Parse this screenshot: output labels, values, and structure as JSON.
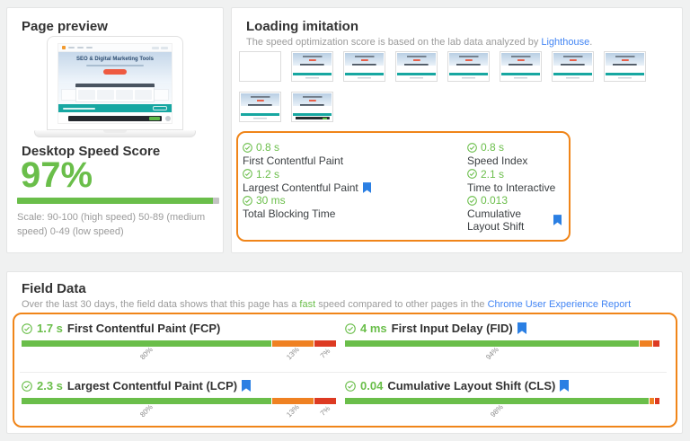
{
  "colors": {
    "green": "#6abe4a",
    "orange": "#ef8122",
    "red": "#dd3a22",
    "link_blue": "#4285f4",
    "bookmark_blue": "#2b7fe3",
    "highlight_border": "#f08519"
  },
  "page_preview": {
    "title": "Page preview",
    "site_heading": "SEO & Digital Marketing Tools",
    "score_heading": "Desktop Speed Score",
    "score_value": "97%",
    "score_percent": 97,
    "scale_note": "Scale: 90-100 (high speed) 50-89 (medium speed) 0-49 (low speed)"
  },
  "loading_imitation": {
    "title": "Loading imitation",
    "subtitle": {
      "prefix": "The speed optimization score is based on the lab data analyzed by ",
      "link": "Lighthouse",
      "suffix": "."
    },
    "filmstrip": {
      "frames": [
        "blank",
        "loaded",
        "loaded",
        "loaded",
        "loaded",
        "loaded",
        "loaded",
        "loaded",
        "loaded",
        "cookiebar"
      ]
    },
    "metrics": [
      {
        "value": "0.8 s",
        "label": "First Contentful Paint",
        "bookmark": false
      },
      {
        "value": "0.8 s",
        "label": "Speed Index",
        "bookmark": false
      },
      {
        "value": "1.2 s",
        "label": "Largest Contentful Paint",
        "bookmark": true
      },
      {
        "value": "2.1 s",
        "label": "Time to Interactive",
        "bookmark": false
      },
      {
        "value": "30 ms",
        "label": "Total Blocking Time",
        "bookmark": false
      },
      {
        "value": "0.013",
        "label": "Cumulative Layout Shift",
        "bookmark": true
      }
    ]
  },
  "field_data": {
    "title": "Field Data",
    "subtitle": {
      "prefix": "Over the last 30 days, the field data shows that this page has a ",
      "highlight": "fast",
      "middle": " speed compared to other pages in the ",
      "link": "Chrome User Experience Report"
    },
    "metrics": [
      {
        "value": "1.7 s",
        "label": "First Contentful Paint (FCP)",
        "bookmark": false,
        "segments": [
          {
            "color": "green",
            "pct": 80,
            "label": "80%"
          },
          {
            "color": "orange",
            "pct": 13,
            "label": "13%"
          },
          {
            "color": "red",
            "pct": 7,
            "label": "7%"
          }
        ]
      },
      {
        "value": "4 ms",
        "label": "First Input Delay (FID)",
        "bookmark": true,
        "segments": [
          {
            "color": "green",
            "pct": 94,
            "label": "94%"
          },
          {
            "color": "orange",
            "pct": 4,
            "label": ""
          },
          {
            "color": "red",
            "pct": 2,
            "label": ""
          }
        ]
      },
      {
        "value": "2.3 s",
        "label": "Largest Contentful Paint (LCP)",
        "bookmark": true,
        "segments": [
          {
            "color": "green",
            "pct": 80,
            "label": "80%"
          },
          {
            "color": "orange",
            "pct": 13,
            "label": "13%"
          },
          {
            "color": "red",
            "pct": 7,
            "label": "7%"
          }
        ]
      },
      {
        "value": "0.04",
        "label": "Cumulative Layout Shift (CLS)",
        "bookmark": true,
        "segments": [
          {
            "color": "green",
            "pct": 97,
            "label": "98%"
          },
          {
            "color": "orange",
            "pct": 1.5,
            "label": ""
          },
          {
            "color": "red",
            "pct": 1.5,
            "label": ""
          }
        ]
      }
    ]
  }
}
